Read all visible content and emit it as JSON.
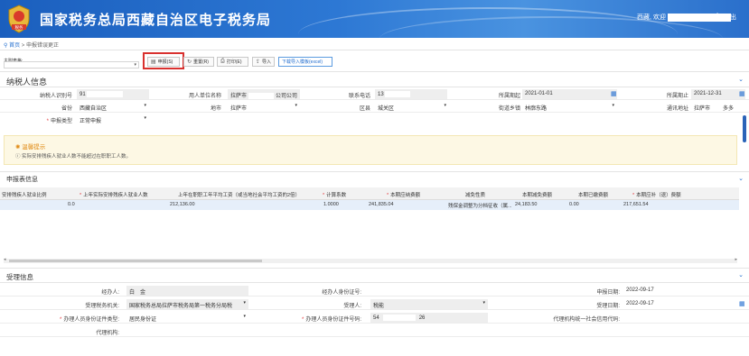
{
  "header": {
    "title": "国家税务总局西藏自治区电子税务局",
    "user_prefix": "西藏, 欢迎",
    "separator": "|",
    "exit": "退出",
    "emblem_text": "税务"
  },
  "breadcrumb": {
    "home": "首页",
    "sep": ">",
    "current": "申报错误更正"
  },
  "toolbar": {
    "field_label": "主附表格:",
    "declare": "申报(S)",
    "reset": "重置(R)",
    "print": "打印(E)",
    "import": "导入",
    "download": "下载导入模板(excel)"
  },
  "taxpayer": {
    "section_title": "纳税人信息",
    "row1": {
      "tin_label": "纳税人识别号",
      "tin_value": "91",
      "employer_label": "用人单位名称",
      "employer_prefix": "拉萨市",
      "employer_suffix": "公司公司",
      "phone_label": "联系电话",
      "phone_value": "13",
      "period_start_label": "所属期起",
      "period_start": "2021-01-01",
      "period_end_label": "所属期止",
      "period_end": "2021-12-31"
    },
    "row2": {
      "province_label": "省份",
      "province": "西藏自治区",
      "city_label": "地市",
      "city": "拉萨市",
      "district_label": "区县",
      "district": "城关区",
      "street_label": "街道乡镇",
      "street": "林廓东路",
      "address_label": "通讯地址",
      "address": "拉萨市",
      "address_tail": "多多"
    },
    "row3": {
      "type_label": "申报类型",
      "type": "正常申报"
    }
  },
  "tip": {
    "title": "温馨提示",
    "text": "实际安排残疾人就业人数不能超过在职职工人数。"
  },
  "declare": {
    "section_title": "申报表信息",
    "columns": [
      "安排残疾人就业比例",
      "上年实际安排残疾人就业人数",
      "上年在职职工年平均工资（或当地社会平均工资的2倍）",
      "计算系数",
      "本期应纳费额",
      "减免性质",
      "本期减免费额",
      "本期已缴费额",
      "本期应补（退）费额"
    ],
    "required": [
      false,
      true,
      false,
      true,
      true,
      false,
      false,
      false,
      true
    ],
    "row": [
      "0.0",
      "",
      "212,136.00",
      "1.0000",
      "241,835.04",
      "残保金调整为分档征收（属...",
      "24,183.50",
      "0.00",
      "217,651.54"
    ]
  },
  "acceptance": {
    "section_title": "受理信息",
    "handler_label": "经办人:",
    "handler": "白　金",
    "handler_id_label": "经办人身份证号:",
    "handler_id": "",
    "declare_date_label": "申报日期:",
    "declare_date": "2022-09-17",
    "tax_office_label": "受理税务机关:",
    "tax_office": "国家税务总局拉萨市税务局第一税务分局税",
    "receiver_label": "受理人:",
    "receiver": "税能",
    "accept_date_label": "受理日期:",
    "accept_date": "2022-09-17",
    "id_type_label": "办理人员身份证件类型:",
    "id_type": "居民身份证",
    "id_no_label": "办理人员身份证件号码:",
    "id_no_prefix": "54",
    "id_no_suffix": "26",
    "agent_code_label": "代理机构统一社会信用代码:",
    "agent_code": "",
    "agent_label": "代理机构:",
    "agent": ""
  }
}
